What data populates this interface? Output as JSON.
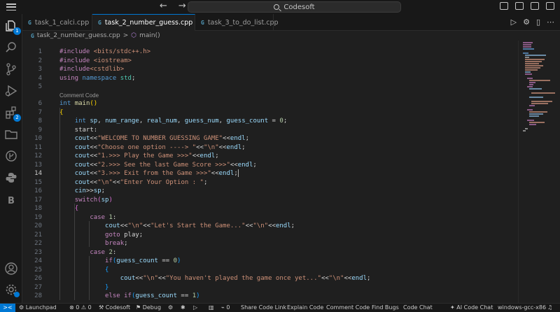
{
  "titlebar": {
    "search_text": "Codesoft"
  },
  "activity": {
    "explorer_badge": "1",
    "extensions_badge": "2",
    "letter_item": "B"
  },
  "tabs": [
    {
      "label": "task_1_calci.cpp"
    },
    {
      "label": "task_2_number_guess.cpp"
    },
    {
      "label": "task_3_to_do_list.cpp"
    }
  ],
  "breadcrumb": {
    "file": "task_2_number_guess.cpp",
    "separator": ">",
    "symbol": "main()"
  },
  "editor": {
    "codelens": "Comment Code",
    "line_numbers": [
      "1",
      "2",
      "3",
      "4",
      "5",
      "6",
      "7",
      "8",
      "9",
      "10",
      "11",
      "12",
      "13",
      "14",
      "15",
      "16",
      "17",
      "18",
      "19",
      "20",
      "21",
      "22",
      "23",
      "24",
      "25",
      "26",
      "27",
      "28"
    ]
  },
  "statusbar": {
    "launchpad": "Launchpad",
    "errors": "0",
    "warnings": "0",
    "branch": "Codesoft",
    "debug": "Debug",
    "ports": "0",
    "share_code_link": "Share Code Link",
    "explain_code": "Explain Code",
    "comment_code": "Comment Code",
    "find_bugs": "Find Bugs",
    "code_chat": "Code Chat",
    "ai_code_chat": "AI Code Chat",
    "compiler": "windows-gcc-x86"
  }
}
